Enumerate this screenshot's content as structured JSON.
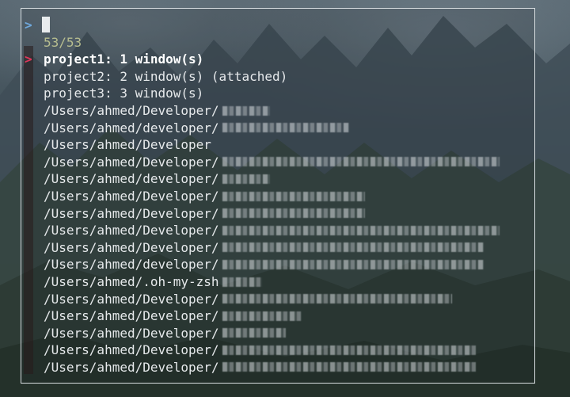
{
  "prompt": {
    "symbol": ">"
  },
  "match_count": "53/53",
  "pointer_symbol": ">",
  "selected_index": 0,
  "items": [
    {
      "label": "project1: 1 window(s)",
      "redacted_width": 0
    },
    {
      "label": "project2: 2 window(s) (attached)",
      "redacted_width": 0
    },
    {
      "label": "project3: 3 window(s)",
      "redacted_width": 0
    },
    {
      "label": "/Users/ahmed/Developer/",
      "redacted_width": 60
    },
    {
      "label": "/Users/ahmed/developer/",
      "redacted_width": 160
    },
    {
      "label": "/Users/ahmed/Developer",
      "redacted_width": 0
    },
    {
      "label": "/Users/ahmed/Developer/",
      "redacted_width": 350
    },
    {
      "label": "/Users/ahmed/developer/",
      "redacted_width": 60
    },
    {
      "label": "/Users/ahmed/Developer/",
      "redacted_width": 180
    },
    {
      "label": "/Users/ahmed/Developer/",
      "redacted_width": 180
    },
    {
      "label": "/Users/ahmed/Developer/",
      "redacted_width": 350
    },
    {
      "label": "/Users/ahmed/Developer/",
      "redacted_width": 330
    },
    {
      "label": "/Users/ahmed/developer/",
      "redacted_width": 330
    },
    {
      "label": "/Users/ahmed/.oh-my-zsh",
      "redacted_width": 50
    },
    {
      "label": "/Users/ahmed/Developer/",
      "redacted_width": 290
    },
    {
      "label": "/Users/ahmed/Developer/",
      "redacted_width": 100
    },
    {
      "label": "/Users/ahmed/Developer/",
      "redacted_width": 80
    },
    {
      "label": "/Users/ahmed/Developer/",
      "redacted_width": 320
    },
    {
      "label": "/Users/ahmed/Developer/",
      "redacted_width": 320
    }
  ],
  "colors": {
    "prompt": "#6fa8dc",
    "count": "#b7bd8f",
    "pointer": "#e0365b",
    "text": "#e6e9eb",
    "frame_border": "#d7dde0"
  }
}
